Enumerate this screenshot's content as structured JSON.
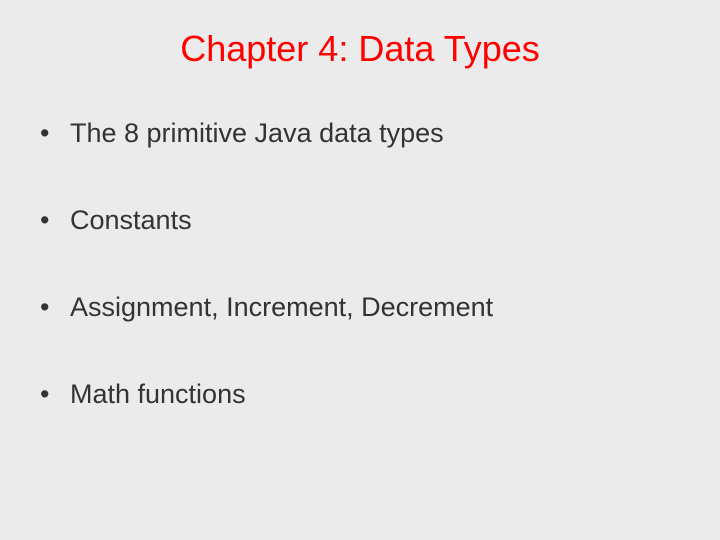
{
  "title": "Chapter 4: Data Types",
  "bullets": {
    "item0": "The 8 primitive Java data types",
    "item1": "Constants",
    "item2": "Assignment, Increment, Decrement",
    "item3": "Math functions"
  }
}
